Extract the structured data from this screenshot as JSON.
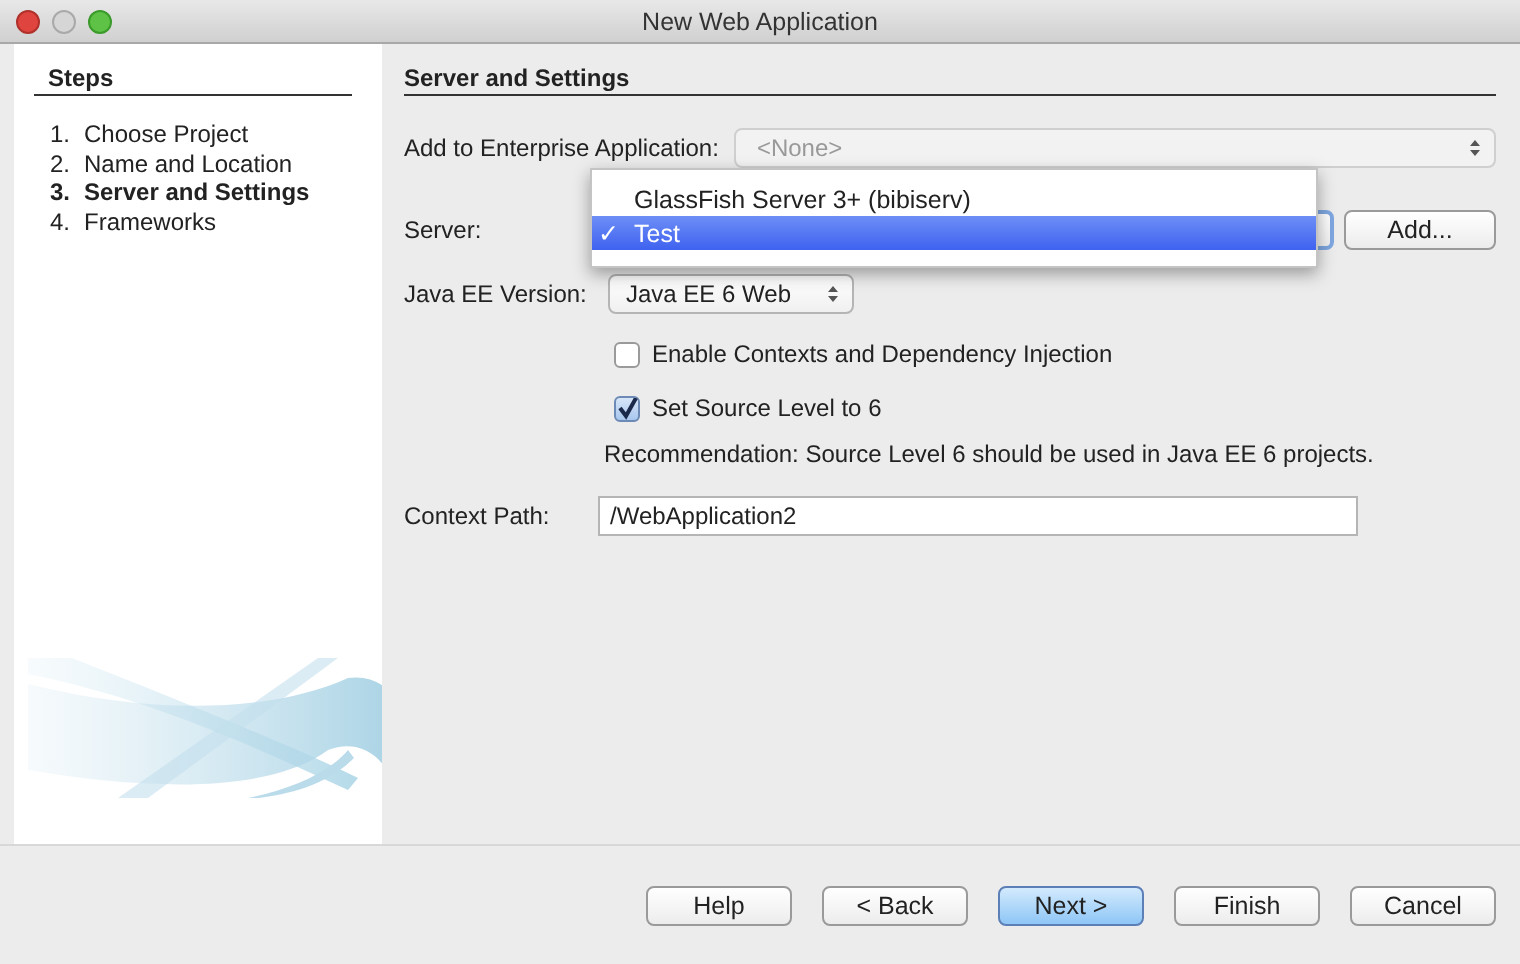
{
  "window": {
    "title": "New Web Application"
  },
  "steps": {
    "heading": "Steps",
    "items": [
      {
        "number": "1.",
        "label": "Choose Project",
        "selected": false
      },
      {
        "number": "2.",
        "label": "Name and Location",
        "selected": false
      },
      {
        "number": "3.",
        "label": "Server and Settings",
        "selected": true
      },
      {
        "number": "4.",
        "label": "Frameworks",
        "selected": false
      }
    ]
  },
  "settings": {
    "heading": "Server and Settings",
    "enterprise": {
      "label": "Add to Enterprise Application:",
      "value": "<None>",
      "disabled": true
    },
    "server": {
      "label": "Server:",
      "add_button": "Add...",
      "menu": [
        {
          "label": "GlassFish Server 3+ (bibiserv)",
          "selected": false
        },
        {
          "label": "Test",
          "selected": true,
          "check": "✓"
        }
      ]
    },
    "java_ee": {
      "label": "Java EE Version:",
      "value": "Java EE 6 Web"
    },
    "checkboxes": [
      {
        "label": "Enable Contexts and Dependency Injection",
        "checked": false
      },
      {
        "label": "Set Source Level to 6",
        "checked": true
      }
    ],
    "recommendation": "Recommendation: Source Level 6 should be used in Java EE 6 projects.",
    "context_path": {
      "label": "Context Path:",
      "value": "/WebApplication2"
    }
  },
  "buttons": [
    {
      "label": "Help",
      "kind": "normal"
    },
    {
      "label": "< Back",
      "kind": "normal"
    },
    {
      "label": "Next >",
      "kind": "default"
    },
    {
      "label": "Finish",
      "kind": "normal"
    },
    {
      "label": "Cancel",
      "kind": "normal"
    }
  ]
}
